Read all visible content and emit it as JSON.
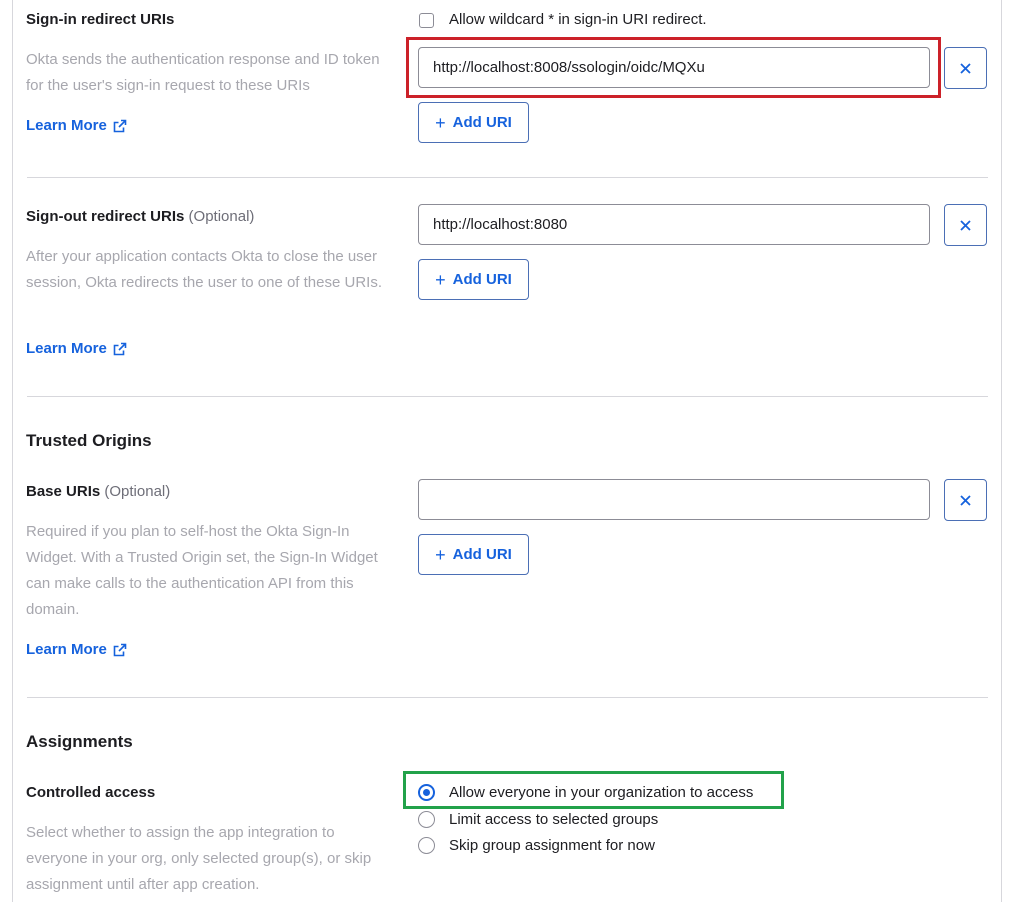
{
  "signin": {
    "label": "Sign-in redirect URIs",
    "wildcard_label": "Allow wildcard * in sign-in URI redirect.",
    "description": "Okta sends the authentication response and ID token for the user's sign-in request to these URIs",
    "learn_more": "Learn More",
    "uri_value": "http://localhost:8008/ssologin/oidc/MQXu",
    "add_uri": "Add URI"
  },
  "signout": {
    "label": "Sign-out redirect URIs",
    "optional": "(Optional)",
    "description": "After your application contacts Okta to close the user session, Okta redirects the user to one of these URIs.",
    "learn_more": "Learn More",
    "uri_value": "http://localhost:8080",
    "add_uri": "Add URI"
  },
  "trusted_origins": {
    "heading": "Trusted Origins",
    "label": "Base URIs",
    "optional": "(Optional)",
    "description": "Required if you plan to self-host the Okta Sign-In Widget. With a Trusted Origin set, the Sign-In Widget can make calls to the authentication API from this domain.",
    "learn_more": "Learn More",
    "uri_value": "",
    "add_uri": "Add URI"
  },
  "assignments": {
    "heading": "Assignments",
    "label": "Controlled access",
    "description": "Select whether to assign the app integration to everyone in your org, only selected group(s), or skip assignment until after app creation.",
    "options": [
      {
        "label": "Allow everyone in your organization to access",
        "selected": true
      },
      {
        "label": "Limit access to selected groups",
        "selected": false
      },
      {
        "label": "Skip group assignment for now",
        "selected": false
      }
    ]
  },
  "colors": {
    "link": "#1662dd",
    "highlight_red": "#cc2129",
    "highlight_green": "#22a24a"
  }
}
